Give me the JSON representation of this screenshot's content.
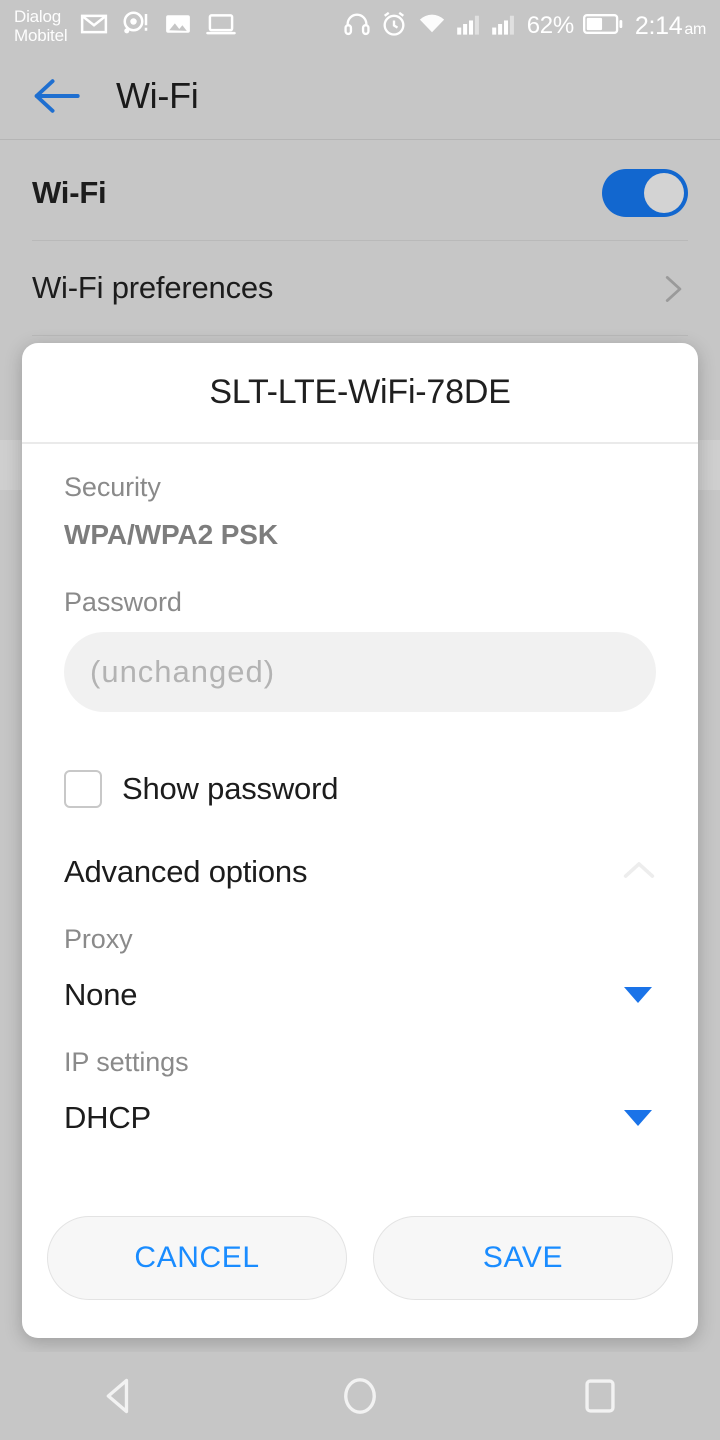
{
  "status_bar": {
    "carrier": "Dialog\nMobitel",
    "icons_left": [
      "gmail-icon",
      "location-alert-icon",
      "photos-icon",
      "laptop-icon"
    ],
    "icons_right": [
      "headphones-icon",
      "alarm-icon",
      "wifi-icon",
      "signal-sim1-icon",
      "signal-sim2-icon"
    ],
    "battery_percent": "62%",
    "battery_icon": "battery-icon",
    "time": "2:14",
    "ampm": "am"
  },
  "appbar": {
    "back_icon": "back-arrow-icon",
    "title": "Wi-Fi"
  },
  "settings": {
    "wifi_row_label": "Wi-Fi",
    "wifi_toggle_state": "on",
    "preferences_label": "Wi-Fi preferences",
    "chevron_icon": "chevron-right-icon"
  },
  "dialog": {
    "title": "SLT-LTE-WiFi-78DE",
    "security_label": "Security",
    "security_value": "WPA/WPA2 PSK",
    "password_label": "Password",
    "password_value": "",
    "password_placeholder": "(unchanged)",
    "show_password_label": "Show password",
    "show_password_checked": "false",
    "advanced_options_label": "Advanced options",
    "advanced_collapse_icon": "chevron-up-icon",
    "proxy_label": "Proxy",
    "proxy_value": "None",
    "ip_settings_label": "IP settings",
    "ip_settings_value": "DHCP",
    "dropdown_icon": "triangle-down-icon",
    "cancel_label": "CANCEL",
    "save_label": "SAVE"
  },
  "navbar": {
    "back_icon": "nav-back-triangle-icon",
    "home_icon": "nav-home-circle-icon",
    "recents_icon": "nav-recents-square-icon"
  },
  "colors": {
    "accent_blue": "#1a73e8",
    "link_blue": "#1a8cff",
    "toggle_blue": "#1267cf",
    "scrim_gray": "#c6c6c6",
    "dialog_white": "#ffffff"
  }
}
